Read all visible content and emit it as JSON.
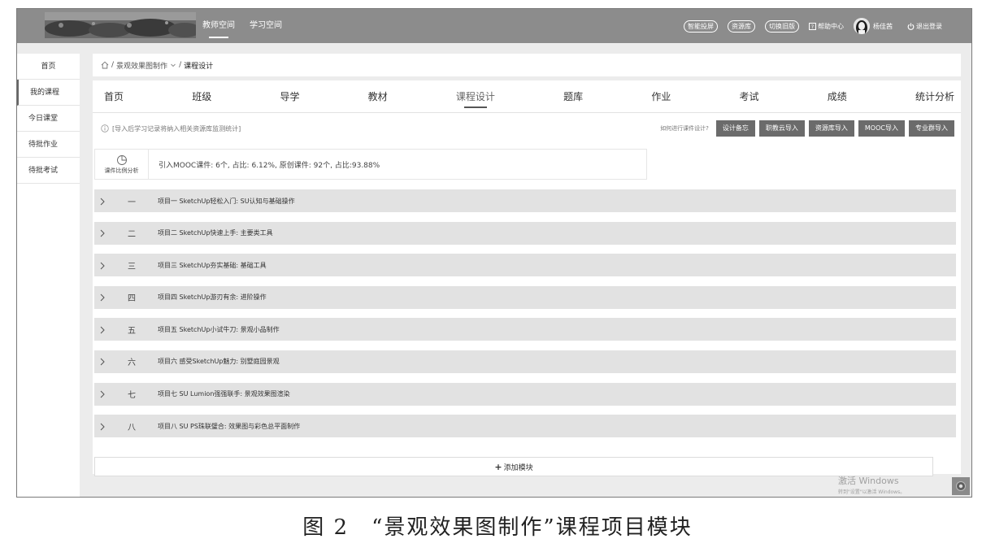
{
  "topbar": {
    "nav": [
      {
        "label": "教师空间",
        "active": true
      },
      {
        "label": "学习空间",
        "active": false
      }
    ],
    "pills": [
      "智能投屏",
      "资源库",
      "切换旧版"
    ],
    "help_label": "帮助中心",
    "user_name": "杨佳茜",
    "logout_label": "退出登录"
  },
  "sidebar": {
    "items": [
      {
        "label": "首页"
      },
      {
        "label": "我的课程"
      },
      {
        "label": "今日课堂"
      },
      {
        "label": "待批作业"
      },
      {
        "label": "待批考试"
      }
    ]
  },
  "breadcrumb": {
    "course": "景观效果图制作",
    "current": "课程设计",
    "separator": "/"
  },
  "tabs": [
    "首页",
    "班级",
    "导学",
    "教材",
    "课程设计",
    "题库",
    "作业",
    "考试",
    "成绩",
    "统计分析"
  ],
  "active_tab": "课程设计",
  "info": {
    "notice": "[导入后学习记录将纳入相关资源库监测统计]",
    "how_label": "如何进行课件设计?",
    "buttons": [
      "设计备忘",
      "职教云导入",
      "资源库导入",
      "MOOC导入",
      "专业群导入"
    ]
  },
  "ratio": {
    "label": "课件比例分析",
    "text": "引入MOOC课件: 6个, 占比: 6.12%, 原创课件: 92个, 占比:93.88%"
  },
  "modules": [
    {
      "num": "一",
      "title": "项目一 SketchUp轻松入门: SU认知与基础操作"
    },
    {
      "num": "二",
      "title": "项目二 SketchUp快速上手: 主要类工具"
    },
    {
      "num": "三",
      "title": "项目三 SketchUp夯实基础: 基础工具"
    },
    {
      "num": "四",
      "title": "项目四 SketchUp游刃有余: 进阶操作"
    },
    {
      "num": "五",
      "title": "项目五 SketchUp小试牛刀: 景观小品制作"
    },
    {
      "num": "六",
      "title": "项目六 感受SketchUp魅力: 别墅庭园景观"
    },
    {
      "num": "七",
      "title": "项目七 SU Lumion强强联手: 景观效果图渲染"
    },
    {
      "num": "八",
      "title": "项目八 SU PS珠联璧合: 效果图与彩色总平面制作"
    }
  ],
  "add_module_label": "添加模块",
  "watermark": {
    "line1": "激活 Windows",
    "line2": "转到\"设置\"以激活 Windows。"
  },
  "caption": "图 2　“景观效果图制作”课程项目模块",
  "colors": {
    "topbar": "#8c8c8c",
    "button": "#6b6b6b",
    "module_row": "#e2e2e2",
    "page_bg": "#ececec"
  }
}
